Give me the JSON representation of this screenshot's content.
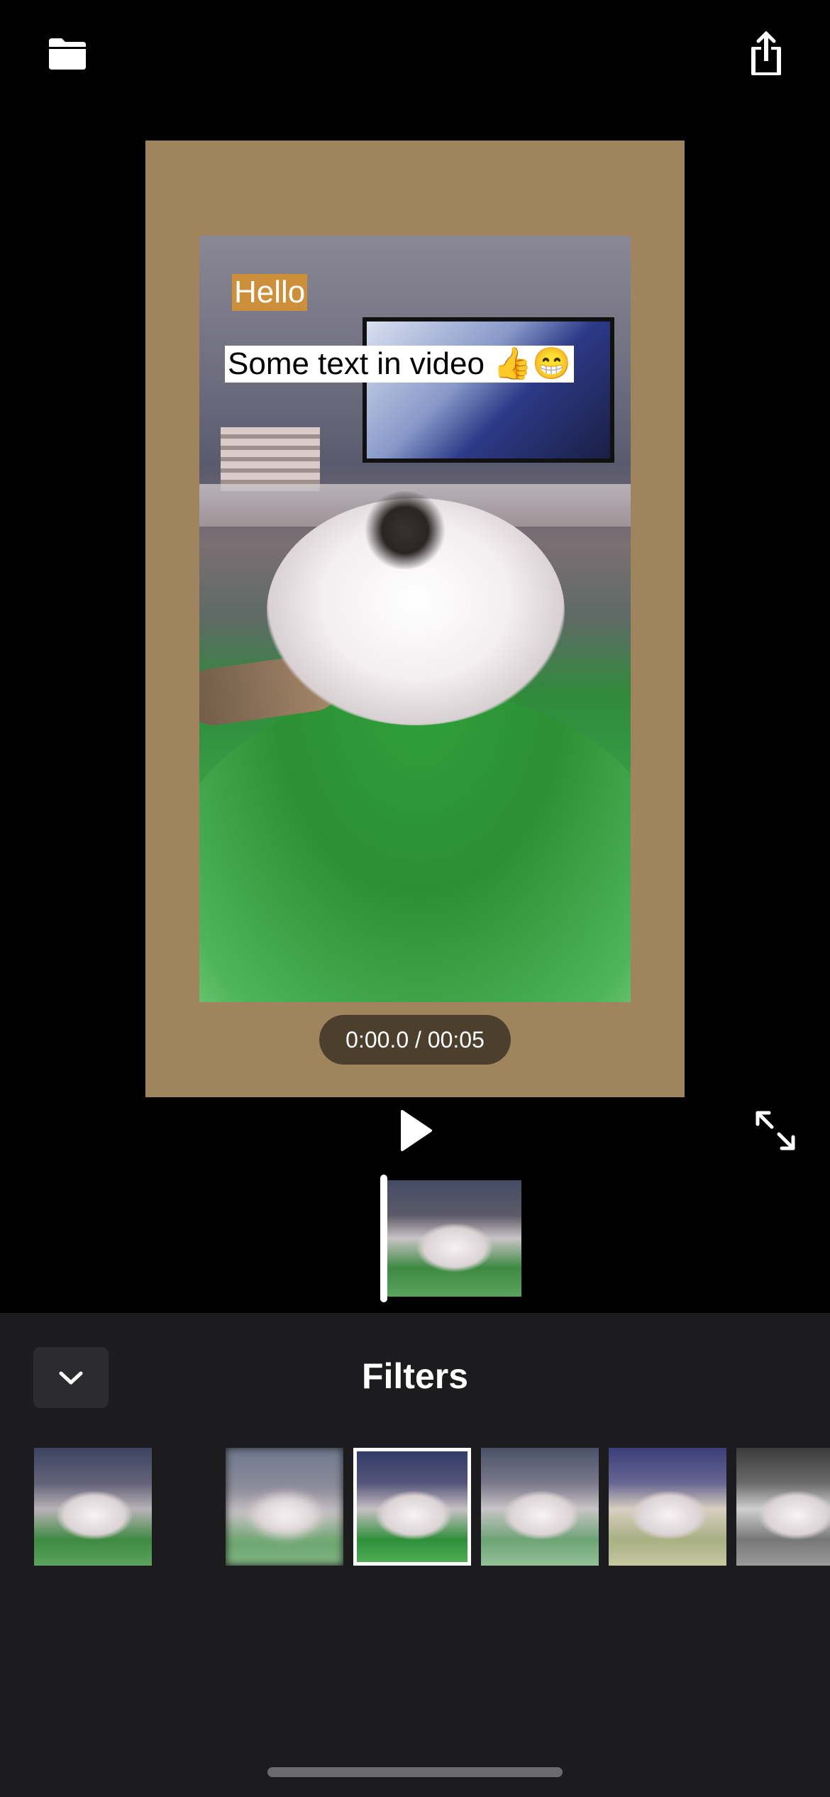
{
  "toolbar": {
    "folder_icon": "folder-icon",
    "share_icon": "share-icon"
  },
  "video": {
    "overlay_hello": "Hello",
    "overlay_caption": "Some text in video 👍😁",
    "border_color": "#a0845d",
    "hello_bg_color": "#cd8f3a"
  },
  "playback": {
    "timecode": "0:00.0 / 00:05",
    "play_icon": "play-icon",
    "fullscreen_icon": "expand-icon"
  },
  "filters_panel": {
    "title": "Filters",
    "collapse_icon": "chevron-down-icon",
    "selected_index": 3,
    "thumbnails": [
      {
        "style": "normal"
      },
      {
        "style": "blank"
      },
      {
        "style": "blur"
      },
      {
        "style": "chrome"
      },
      {
        "style": "fade"
      },
      {
        "style": "instant"
      },
      {
        "style": "mono"
      }
    ]
  }
}
